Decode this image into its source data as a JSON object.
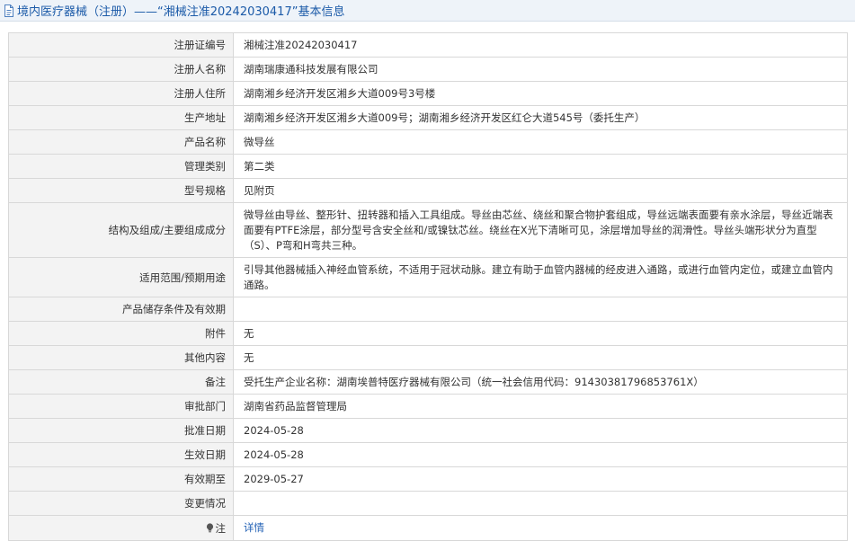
{
  "header": {
    "title": "境内医疗器械（注册）——“湘械注准20242030417”基本信息"
  },
  "rows": [
    {
      "label": "注册证编号",
      "value": "湘械注准20242030417"
    },
    {
      "label": "注册人名称",
      "value": "湖南瑞康通科技发展有限公司"
    },
    {
      "label": "注册人住所",
      "value": "湖南湘乡经济开发区湘乡大道009号3号楼"
    },
    {
      "label": "生产地址",
      "value": "湖南湘乡经济开发区湘乡大道009号；湖南湘乡经济开发区红仑大道545号（委托生产）"
    },
    {
      "label": "产品名称",
      "value": "微导丝"
    },
    {
      "label": "管理类别",
      "value": "第二类"
    },
    {
      "label": "型号规格",
      "value": "见附页"
    },
    {
      "label": "结构及组成/主要组成成分",
      "value": "微导丝由导丝、整形针、扭转器和插入工具组成。导丝由芯丝、绕丝和聚合物护套组成，导丝远端表面要有亲水涂层，导丝近端表面要有PTFE涂层，部分型号含安全丝和/或镍钛芯丝。绕丝在X光下清晰可见，涂层增加导丝的润滑性。导丝头端形状分为直型（S）、P弯和H弯共三种。"
    },
    {
      "label": "适用范围/预期用途",
      "value": "引导其他器械插入神经血管系统，不适用于冠状动脉。建立有助于血管内器械的经皮进入通路，或进行血管内定位，或建立血管内通路。"
    },
    {
      "label": "产品储存条件及有效期",
      "value": ""
    },
    {
      "label": "附件",
      "value": "无"
    },
    {
      "label": "其他内容",
      "value": "无"
    },
    {
      "label": "备注",
      "value": "受托生产企业名称：湖南埃普特医疗器械有限公司（统一社会信用代码：91430381796853761X）"
    },
    {
      "label": "审批部门",
      "value": "湖南省药品监督管理局"
    },
    {
      "label": "批准日期",
      "value": "2024-05-28"
    },
    {
      "label": "生效日期",
      "value": "2024-05-28"
    },
    {
      "label": "有效期至",
      "value": "2029-05-27"
    },
    {
      "label": "变更情况",
      "value": ""
    }
  ],
  "note": {
    "label": "注",
    "link": "详情"
  }
}
